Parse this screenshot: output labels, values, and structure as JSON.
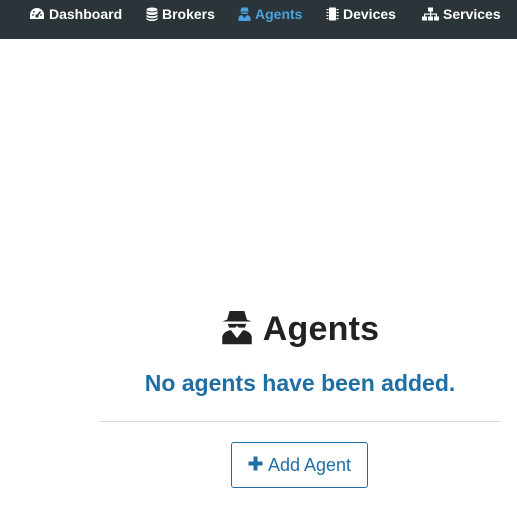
{
  "nav": {
    "items": [
      {
        "label": "Dashboard",
        "icon": "dashboard-gauge-icon",
        "active": false
      },
      {
        "label": "Brokers",
        "icon": "database-icon",
        "active": false
      },
      {
        "label": "Agents",
        "icon": "user-secret-icon",
        "active": true
      },
      {
        "label": "Devices",
        "icon": "microchip-icon",
        "active": false
      },
      {
        "label": "Services",
        "icon": "sitemap-icon",
        "active": false
      }
    ],
    "active_color": "#4aa3df",
    "background": "#2b3438"
  },
  "main": {
    "title": "Agents",
    "title_icon": "user-secret-icon",
    "empty_message": "No agents have been added.",
    "empty_message_color": "#1f6fa5",
    "add_button_label": "Add Agent",
    "add_button_icon": "plus-icon"
  }
}
